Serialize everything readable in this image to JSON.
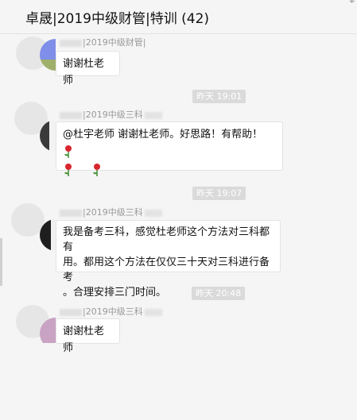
{
  "header": {
    "title": "卓晟|2019中级财管|特训 (42)",
    "corner_icon": "pin-icon"
  },
  "messages": [
    {
      "sender": "|2019中级财管|",
      "text": "谢谢杜老师",
      "avatar_colors": [
        "#7f8ee8",
        "#9fb06a"
      ]
    },
    {
      "time": "昨天 19:01",
      "sender": "|2019中级三科",
      "text": "@杜宇老师 谢谢杜老师。好思路！有帮助！",
      "emoji": "rose-emoji",
      "avatar_colors": [
        "#3a3a3a",
        "#f2f2f2"
      ]
    },
    {
      "time": "昨天 19:07",
      "sender": "|2019中级三科",
      "text_lines": [
        "我是备考三科，感觉杜老师这个方法对三科都有",
        "用。都用这个方法在仅仅三十天对三科进行备考",
        "。合理安排三门时间。"
      ],
      "avatar_colors": [
        "#1e1e1e",
        "#f0f0f0"
      ]
    },
    {
      "time": "昨天 20:48",
      "sender": "|2019中级三科",
      "text": "谢谢杜老师",
      "avatar_colors": [
        "#c9a3c3",
        "#c9a3c3"
      ]
    }
  ],
  "colors": {
    "background": "#f5f5f5",
    "bubble": "#ffffff",
    "time_badge": "#dadada",
    "rose_petal": "#d8262e",
    "rose_stem": "#3e8d2f"
  }
}
